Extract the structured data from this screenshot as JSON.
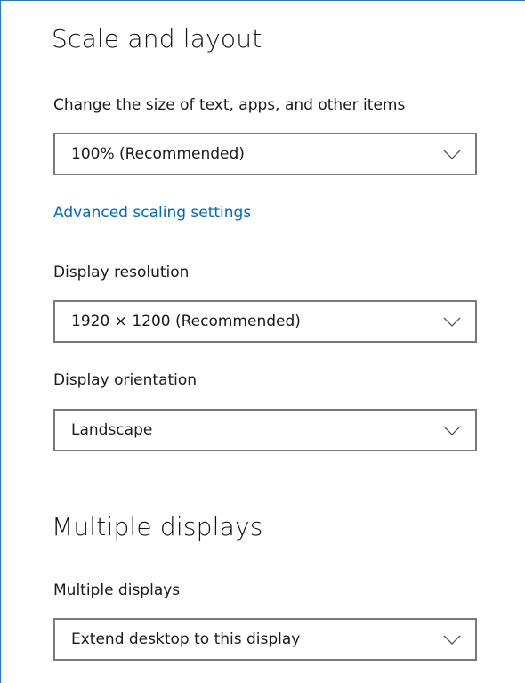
{
  "scale_layout": {
    "title": "Scale and layout",
    "size_label": "Change the size of text, apps, and other items",
    "size_value": "100% (Recommended)",
    "advanced_link": "Advanced scaling settings",
    "resolution_label": "Display resolution",
    "resolution_value": "1920 × 1200 (Recommended)",
    "orientation_label": "Display orientation",
    "orientation_value": "Landscape"
  },
  "multiple_displays": {
    "title": "Multiple displays",
    "label": "Multiple displays",
    "value": "Extend desktop to this display"
  },
  "icons": {
    "dropdown_chevron": "chevron-down-icon"
  },
  "colors": {
    "link": "#0067c0",
    "window_border": "#2b78c7",
    "dropdown_border": "#7a7a7a"
  }
}
